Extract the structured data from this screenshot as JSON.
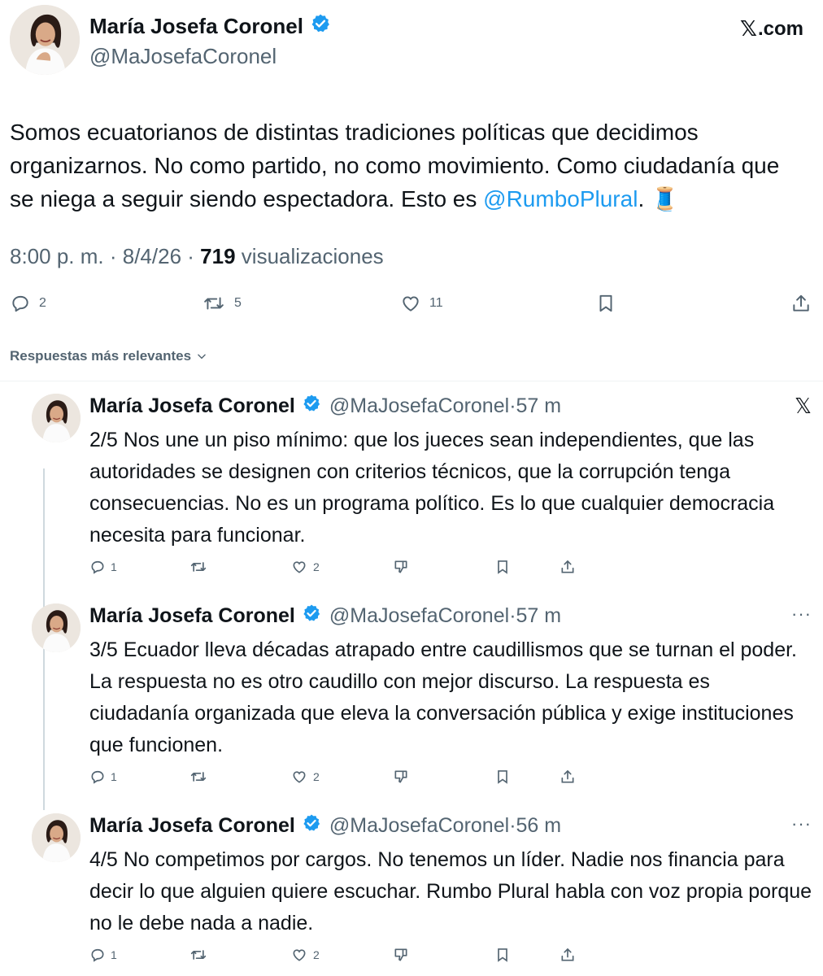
{
  "site": {
    "brand_glyph": "𝕏",
    "brand_suffix": ".com"
  },
  "main_tweet": {
    "author_name": "María Josefa Coronel",
    "handle": "@MaJosefaCoronel",
    "text_before_link": "Somos ecuatorianos de distintas tradiciones políticas que decidimos organizarnos. No como partido, no como movimiento. Como ciudadanía que se niega a seguir siendo espectadora. Esto es ",
    "link_text": "@RumboPlural",
    "text_after_link": ". 🧵",
    "time": "8:00 p. m.",
    "date": "8/4/26",
    "views_count": "719",
    "views_label": "visualizaciones",
    "replies": "2",
    "reposts": "5",
    "likes": "11"
  },
  "replies_filter": {
    "label": "Respuestas más relevantes"
  },
  "replies": [
    {
      "author_name": "María Josefa Coronel",
      "handle": "@MaJosefaCoronel",
      "age": "57 m",
      "text": "2/5 Nos une un piso mínimo: que los jueces sean independientes, que las autoridades se designen con criterios técnicos, que la corrupción tenga consecuencias. No es un programa político. Es lo que cualquier democracia necesita para funcionar.",
      "replies": "1",
      "likes": "2"
    },
    {
      "author_name": "María Josefa Coronel",
      "handle": "@MaJosefaCoronel",
      "age": "57 m",
      "text": "3/5 Ecuador lleva décadas atrapado entre caudillismos que se turnan el poder. La respuesta no es otro caudillo con mejor discurso. La respuesta es ciudadanía organizada que eleva la conversación pública y exige instituciones que funcionen.",
      "replies": "1",
      "likes": "2"
    },
    {
      "author_name": "María Josefa Coronel",
      "handle": "@MaJosefaCoronel",
      "age": "56 m",
      "text": "4/5 No competimos por cargos. No tenemos un líder. Nadie nos financia para decir lo que alguien quiere escuchar. Rumbo Plural habla con voz propia porque no le debe nada a nadie.",
      "replies": "1",
      "likes": "2"
    }
  ],
  "icons": {
    "verified": "verified-badge-icon",
    "reply": "reply-icon",
    "repost": "repost-icon",
    "like": "heart-icon",
    "dislike": "dislike-icon",
    "bookmark": "bookmark-icon",
    "share": "share-icon",
    "more": "more-dots-icon",
    "x_logo": "x-logo-icon"
  },
  "colors": {
    "accent": "#1d9bf0",
    "muted": "#536471",
    "text": "#0f1419"
  }
}
